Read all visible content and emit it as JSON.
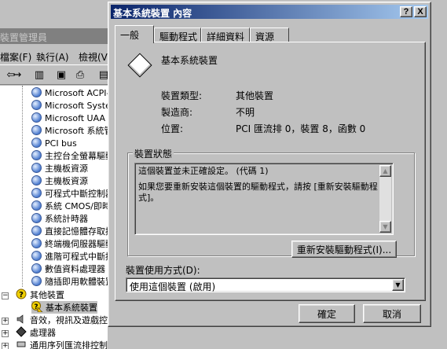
{
  "background_window": {
    "title": "裝置管理員",
    "menu": [
      {
        "label": "檔案(F)"
      },
      {
        "label": "執行(A)"
      },
      {
        "label": "檢視(V)"
      }
    ],
    "tree": {
      "system_devices": [
        "Microsoft ACPI-Compliant System",
        "Microsoft System Management BIOS Driver",
        "Microsoft UAA Bus Driver for High Definition Audio",
        "Microsoft 系統管理 BIOS 驅動程式",
        "PCI bus",
        "主控台全螢幕驅動程式",
        "主機板資源",
        "主機板資源",
        "可程式中斷控制器",
        "系統 CMOS/即時時鐘",
        "系統計時器",
        "直接記憶體存取控制器",
        "終端機伺服器驅動程式",
        "進階可程式中斷控制器",
        "數值資料處理器",
        "隨插即用軟體裝置列舉程式"
      ],
      "other_devices_label": "其他裝置",
      "other_devices_child": "基本系統裝置",
      "audio_label": "音效，視訊及遊戲控制器",
      "processor_label": "處理器",
      "serial_label": "通用序列匯流排控制器"
    }
  },
  "dialog": {
    "title": "基本系統裝置 內容",
    "help_btn": "?",
    "close_btn": "X",
    "tabs": [
      {
        "label": "一般",
        "active": true
      },
      {
        "label": "驅動程式",
        "active": false
      },
      {
        "label": "詳細資料",
        "active": false
      },
      {
        "label": "資源",
        "active": false
      }
    ],
    "device_name": "基本系統裝置",
    "props": {
      "type_label": "裝置類型:",
      "type_value": "其他裝置",
      "mfr_label": "製造商:",
      "mfr_value": "不明",
      "loc_label": "位置:",
      "loc_value": "PCI 匯流排 0，裝置 8，函數 0"
    },
    "status": {
      "legend": "裝置狀態",
      "line1": "這個裝置並未正確設定。 (代碼 1)",
      "line2": "如果您要重新安裝這個裝置的驅動程式，請按 [重新安裝驅動程式]。"
    },
    "reinstall_btn": "重新安裝驅動程式(I)...",
    "usage_label": "裝置使用方式(D):",
    "usage_value": "使用這個裝置 (啟用)",
    "ok_btn": "確定",
    "cancel_btn": "取消"
  }
}
